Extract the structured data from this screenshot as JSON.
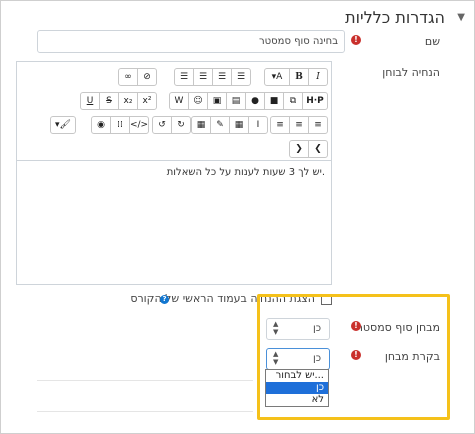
{
  "section": {
    "title": "הגדרות כלליות"
  },
  "fields": {
    "name": {
      "label": "שם",
      "value": "בחינה סוף סמסטר"
    },
    "description": {
      "label": "הנחיה לבוחן",
      "content": "יש לך 3 שעות לענות על כל השאלות.",
      "show_on_course_label": "הצגת ההנחיה בעמוד הראשי של הקורס"
    },
    "final_exam": {
      "label": "מבחן סוף סמסטר",
      "value": "כן"
    },
    "exam_review": {
      "label": "בקרת מבחן",
      "value": "כן",
      "options": [
        "יש לבחור...",
        "כן",
        "לא"
      ],
      "highlighted_option": "כן"
    }
  },
  "toolbar": {
    "row1": [
      "A",
      "B",
      "I",
      "≡",
      "≡",
      "≡",
      "∞",
      "⊘"
    ],
    "row2": [
      "▦",
      "☺",
      "▣",
      "▤",
      "🎙",
      "▶",
      "⧉",
      "H-P",
      "U",
      "S",
      "x₂",
      "x²"
    ],
    "row3": [
      "≡",
      "≡",
      "≡",
      "▦",
      "✎",
      "▦",
      "I",
      "↺",
      "↻",
      "⚙",
      "⁞⁞",
      "</>",
      "🖌"
    ]
  }
}
